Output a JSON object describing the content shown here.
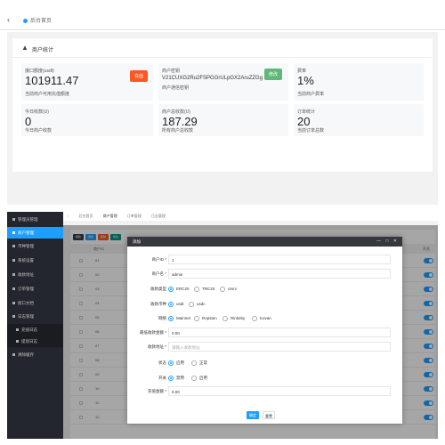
{
  "top": {
    "tab_home": "后台首页",
    "section_title": "商户统计",
    "tiles": [
      {
        "label": "接口额度(usdt)",
        "value": "101911.47",
        "sub": "当前商户可用充值额度",
        "btn": "充值",
        "btn_color": "#ff5722"
      },
      {
        "label": "商户密钥",
        "value": "V21CUXG2Ru2FSPGGrULpGX2AruZZGg",
        "sub": "商户通信密钥",
        "btn": "修改",
        "btn_color": "#5fb878"
      },
      {
        "label": "费率",
        "value": "1%",
        "sub": "当前商户费率"
      },
      {
        "label": "今日收款(U)",
        "value": "0",
        "sub": "今日商户收款"
      },
      {
        "label": "商户总收款(U)",
        "value": "187.29",
        "sub": "所有商户总收款"
      },
      {
        "label": "订单统计",
        "value": "20",
        "sub": "当前订单总数"
      }
    ]
  },
  "sidebar": {
    "items": [
      {
        "label": "管理员管理",
        "active": false,
        "sub": false
      },
      {
        "label": "商户管理",
        "active": true,
        "sub": false
      },
      {
        "label": "币种管理",
        "active": false,
        "sub": false
      },
      {
        "label": "系统设置",
        "active": false,
        "sub": false
      },
      {
        "label": "收款地址",
        "active": false,
        "sub": false
      },
      {
        "label": "订单管理",
        "active": false,
        "sub": false
      },
      {
        "label": "接口文档",
        "active": false,
        "sub": false
      },
      {
        "label": "日志管理",
        "active": false,
        "sub": false
      },
      {
        "label": "充值日志",
        "active": false,
        "sub": true
      },
      {
        "label": "提现日志",
        "active": false,
        "sub": true
      },
      {
        "label": "清除缓存",
        "active": false,
        "sub": false
      }
    ]
  },
  "crumbs": [
    "后台首页",
    "商户管理",
    "订单管理",
    "日志管理"
  ],
  "table": {
    "buttons": [
      {
        "label": "刷新",
        "color": "#393d49"
      },
      {
        "label": "添加",
        "color": "#1e9fff"
      },
      {
        "label": "删除",
        "color": "#ff5722"
      },
      {
        "label": "导出",
        "color": "#009688"
      }
    ],
    "header_id": "商户ID",
    "header_status": "开关",
    "row_ids": [
      "01",
      "02",
      "03",
      "04",
      "05",
      "06",
      "07",
      "08",
      "09",
      "10",
      "11",
      "12"
    ]
  },
  "modal": {
    "title": "添加",
    "controls": "— □ ✕",
    "fields": {
      "merchant_id": {
        "label": "商户ID",
        "value": "1"
      },
      "merchant_name": {
        "label": "商户名",
        "value": "admin"
      },
      "coin_type": {
        "label": "收款类型",
        "options": [
          "ERC20",
          "TRC20",
          "omni"
        ],
        "selected": 0
      },
      "currency": {
        "label": "收款币种",
        "options": [
          "usdt",
          "usdc"
        ],
        "selected": 0
      },
      "network": {
        "label": "网络",
        "options": [
          "Mainnet",
          "Ropsten",
          "Rinkeby",
          "Kovan"
        ],
        "selected": 0
      },
      "min_amount": {
        "label": "最低收款金额",
        "value": "0.00"
      },
      "address": {
        "label": "收款地址",
        "placeholder": "请输入收款地址"
      },
      "status": {
        "label": "状态",
        "options": [
          "启用",
          "正常"
        ],
        "selected": 0
      },
      "switch": {
        "label": "开关",
        "options": [
          "禁用",
          "启用"
        ],
        "selected": 0
      },
      "amount": {
        "label": "充值金额",
        "value": "0.00"
      }
    },
    "confirm": "确定",
    "reset": "重置"
  }
}
